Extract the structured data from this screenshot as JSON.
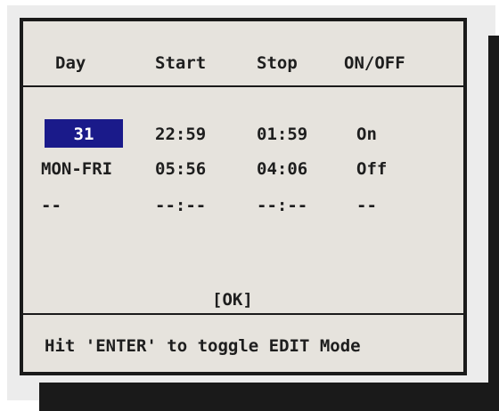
{
  "header": {
    "day": "Day",
    "start": "Start",
    "stop": "Stop",
    "onoff": "ON/OFF"
  },
  "rows": [
    {
      "day": "31",
      "start": "22:59",
      "stop": "01:59",
      "onoff": "On"
    },
    {
      "day": "MON-FRI",
      "start": "05:56",
      "stop": "04:06",
      "onoff": "Off"
    },
    {
      "day": "--",
      "start": "--:--",
      "stop": "--:--",
      "onoff": "--"
    }
  ],
  "ok_label": "[OK]",
  "footer_text": "Hit 'ENTER' to toggle EDIT Mode",
  "colors": {
    "selection": "#1a1a8a",
    "panel": "#e6e3dd",
    "border": "#1a1a1a"
  }
}
